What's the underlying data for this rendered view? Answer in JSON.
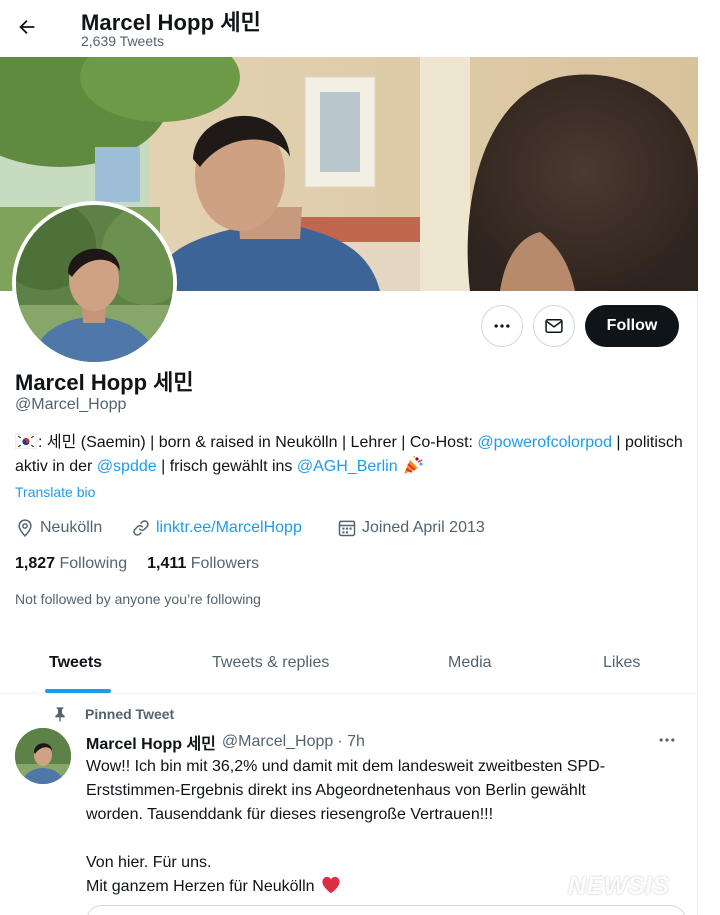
{
  "header": {
    "name": "Marcel Hopp 세민",
    "tweet_count": "2,639 Tweets"
  },
  "profile": {
    "name": "Marcel Hopp 세민",
    "handle": "@Marcel_Hopp",
    "bio": {
      "part1": ": 세민 (Saemin) | born & raised in Neukölln | Lehrer | Co-Host: ",
      "link1": "@powerofcolorpod",
      "part2": " | politisch aktiv in der ",
      "link2": "@spdde",
      "part3": " | frisch gewählt ins ",
      "link3": "@AGH_Berlin",
      "part4": " "
    },
    "translate_label": "Translate bio",
    "location": "Neukölln",
    "website": "linktr.ee/MarcelHopp",
    "joined": "Joined April 2013",
    "following_count": "1,827",
    "following_label": "Following",
    "followers_count": "1,411",
    "followers_label": "Followers",
    "not_followed": "Not followed by anyone you’re following"
  },
  "actions": {
    "follow_label": "Follow"
  },
  "tabs": [
    {
      "label": "Tweets",
      "active": true
    },
    {
      "label": "Tweets & replies",
      "active": false
    },
    {
      "label": "Media",
      "active": false
    },
    {
      "label": "Likes",
      "active": false
    }
  ],
  "pinned_tweet": {
    "pinned_label": "Pinned Tweet",
    "author_name": "Marcel Hopp 세민",
    "author_handle": "@Marcel_Hopp",
    "time": "· 7h",
    "lines": [
      "Wow!! Ich bin mit 36,2% und damit mit dem landesweit zweitbesten SPD-",
      "Erststimmen-Ergebnis direkt ins Abgeordnetenhaus von Berlin gewählt",
      "worden. Tausenddank für dieses riesengroße Vertrauen!!!",
      "Von hier. Für uns.",
      "Mit ganzem Herzen für Neukölln"
    ]
  },
  "watermark": "NEWSIS",
  "icons": {
    "back": "arrow-left-icon",
    "more": "more-dots-icon",
    "message": "envelope-icon",
    "location": "location-pin-icon",
    "link": "link-icon",
    "calendar": "calendar-icon",
    "pin": "pin-icon",
    "flag": "south-korea-flag-icon",
    "party": "party-popper-icon",
    "heart": "red-heart-icon"
  },
  "colors": {
    "accent": "#1d9bf0",
    "text": "#0f1419",
    "secondary_text": "#536471",
    "follow_button": "#0f1419"
  }
}
